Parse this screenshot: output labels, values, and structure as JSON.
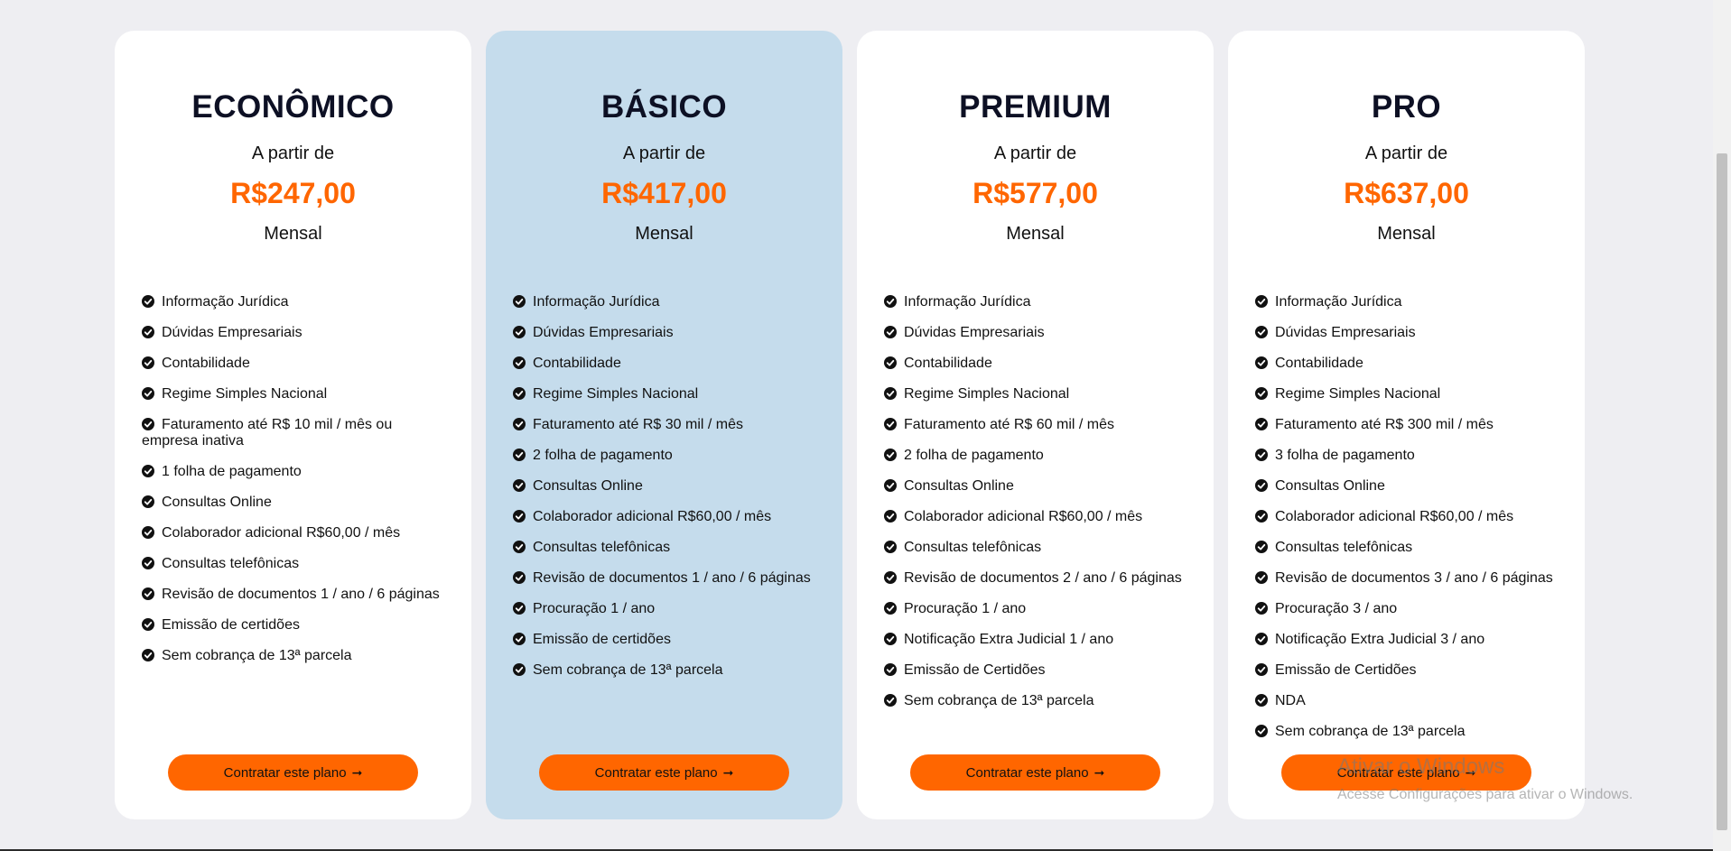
{
  "plans": [
    {
      "name": "ECONÔMICO",
      "from_label": "A partir de",
      "price": "R$247,00",
      "period": "Mensal",
      "features": [
        "Informação Jurídica",
        "Dúvidas Empresariais",
        "Contabilidade",
        "Regime Simples Nacional",
        "Faturamento até R$ 10 mil / mês ou empresa inativa",
        "1 folha de pagamento",
        "Consultas Online",
        "Colaborador adicional R$60,00 / mês",
        "Consultas telefônicas",
        "Revisão de documentos 1 / ano / 6 páginas",
        "Emissão de certidões",
        "Sem cobrança de 13ª parcela"
      ],
      "cta_label": "Contratar este plano",
      "highlighted": false
    },
    {
      "name": "BÁSICO",
      "from_label": "A partir de",
      "price": "R$417,00",
      "period": "Mensal",
      "features": [
        "Informação Jurídica",
        "Dúvidas Empresariais",
        "Contabilidade",
        "Regime Simples Nacional",
        "Faturamento até R$ 30 mil / mês",
        "2 folha de pagamento",
        "Consultas Online",
        "Colaborador adicional R$60,00 / mês",
        "Consultas telefônicas",
        "Revisão de documentos 1 / ano / 6 páginas",
        "Procuração 1 / ano",
        "Emissão de certidões",
        "Sem cobrança de 13ª parcela"
      ],
      "cta_label": "Contratar este plano",
      "highlighted": true
    },
    {
      "name": "PREMIUM",
      "from_label": "A partir de",
      "price": "R$577,00",
      "period": "Mensal",
      "features": [
        "Informação Jurídica",
        "Dúvidas Empresariais",
        "Contabilidade",
        "Regime Simples Nacional",
        "Faturamento até R$ 60 mil / mês",
        "2 folha de pagamento",
        "Consultas Online",
        "Colaborador adicional R$60,00 / mês",
        "Consultas telefônicas",
        "Revisão de documentos 2 / ano / 6 páginas",
        "Procuração 1 / ano",
        "Notificação Extra Judicial 1 / ano",
        "Emissão de Certidões",
        "Sem cobrança de 13ª parcela"
      ],
      "cta_label": "Contratar este plano",
      "highlighted": false
    },
    {
      "name": "PRO",
      "from_label": "A partir de",
      "price": "R$637,00",
      "period": "Mensal",
      "features": [
        " Informação Jurídica",
        "Dúvidas Empresariais",
        "Contabilidade",
        "Regime Simples Nacional",
        "Faturamento até R$ 300 mil / mês",
        "3 folha de pagamento",
        "Consultas Online",
        "Colaborador adicional R$60,00 / mês",
        "Consultas telefônicas",
        "Revisão de documentos 3 / ano / 6 páginas",
        "Procuração 3 / ano",
        "Notificação Extra Judicial 3 / ano",
        "Emissão de Certidões",
        "NDA",
        "Sem cobrança de 13ª parcela"
      ],
      "cta_label": "Contratar este plano",
      "highlighted": false
    }
  ],
  "icons": {
    "feature": "check-circle-icon",
    "cta": "arrow-right-icon"
  },
  "colors": {
    "accent": "#ff6600",
    "highlight_card": "#c5dcec",
    "card": "#ffffff",
    "page_background": "#eeeef2",
    "heading": "#0d1024"
  },
  "watermark": {
    "title": "Ativar o Windows",
    "subtitle": "Acesse Configurações para ativar o Windows."
  }
}
